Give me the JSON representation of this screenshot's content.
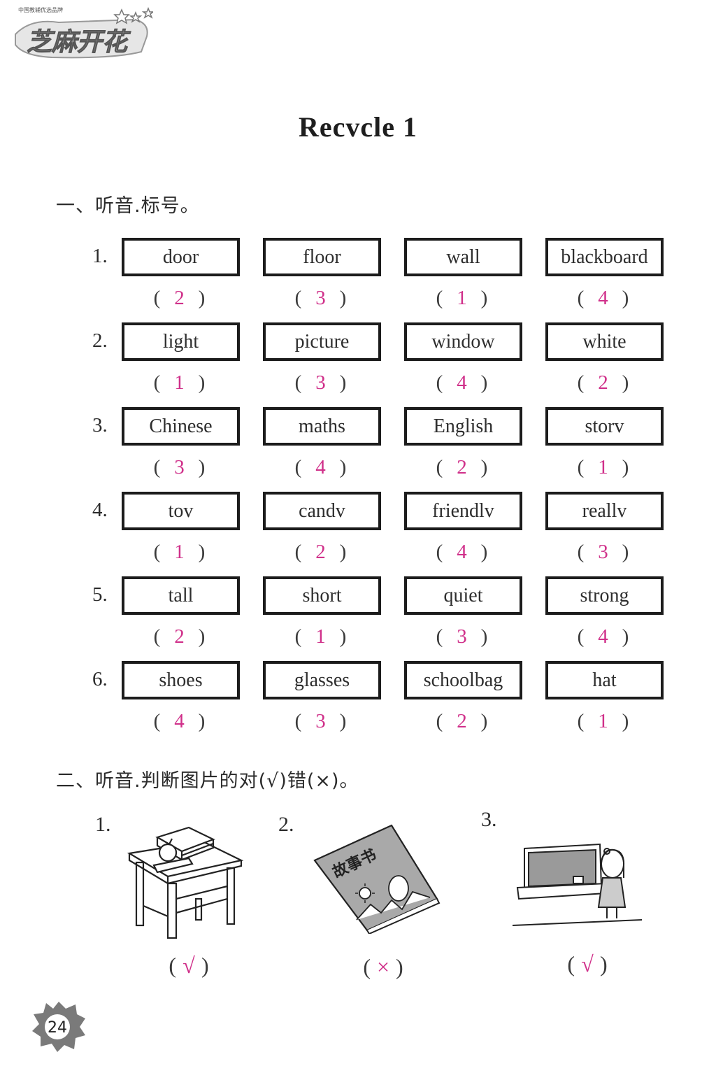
{
  "header": {
    "logo_small_text": "中国教辅优选品牌",
    "logo_text": "芝麻开花"
  },
  "title": "Recvcle 1",
  "section1": {
    "heading": "一、听音.标号。",
    "rows": [
      {
        "num": "1.",
        "items": [
          {
            "word": "door",
            "answer": "2"
          },
          {
            "word": "floor",
            "answer": "3"
          },
          {
            "word": "wall",
            "answer": "1"
          },
          {
            "word": "blackboard",
            "answer": "4"
          }
        ]
      },
      {
        "num": "2.",
        "items": [
          {
            "word": "light",
            "answer": "1"
          },
          {
            "word": "picture",
            "answer": "3"
          },
          {
            "word": "window",
            "answer": "4"
          },
          {
            "word": "white",
            "answer": "2"
          }
        ]
      },
      {
        "num": "3.",
        "items": [
          {
            "word": "Chinese",
            "answer": "3"
          },
          {
            "word": "maths",
            "answer": "4"
          },
          {
            "word": "English",
            "answer": "2"
          },
          {
            "word": "storv",
            "answer": "1"
          }
        ]
      },
      {
        "num": "4.",
        "items": [
          {
            "word": "tov",
            "answer": "1"
          },
          {
            "word": "candv",
            "answer": "2"
          },
          {
            "word": "friendlv",
            "answer": "4"
          },
          {
            "word": "reallv",
            "answer": "3"
          }
        ]
      },
      {
        "num": "5.",
        "items": [
          {
            "word": "tall",
            "answer": "2"
          },
          {
            "word": "short",
            "answer": "1"
          },
          {
            "word": "quiet",
            "answer": "3"
          },
          {
            "word": "strong",
            "answer": "4"
          }
        ]
      },
      {
        "num": "6.",
        "items": [
          {
            "word": "shoes",
            "answer": "4"
          },
          {
            "word": "glasses",
            "answer": "3"
          },
          {
            "word": "schoolbag",
            "answer": "2"
          },
          {
            "word": "hat",
            "answer": "1"
          }
        ]
      }
    ],
    "paren_open": "(",
    "paren_close": ")"
  },
  "section2": {
    "heading": "二、听音.判断图片的对(√)错(×)。",
    "pictures": [
      {
        "num": "1.",
        "subject": "desk-with-books-and-apple",
        "answer": "√"
      },
      {
        "num": "2.",
        "subject": "storybook",
        "book_title": "故事书",
        "answer": "×"
      },
      {
        "num": "3.",
        "subject": "girl-by-blackboard",
        "answer": "√"
      }
    ]
  },
  "page_number": "24",
  "colors": {
    "answer": "#d0308a",
    "text": "#2b2b2b",
    "box_border": "#1c1c1c"
  }
}
